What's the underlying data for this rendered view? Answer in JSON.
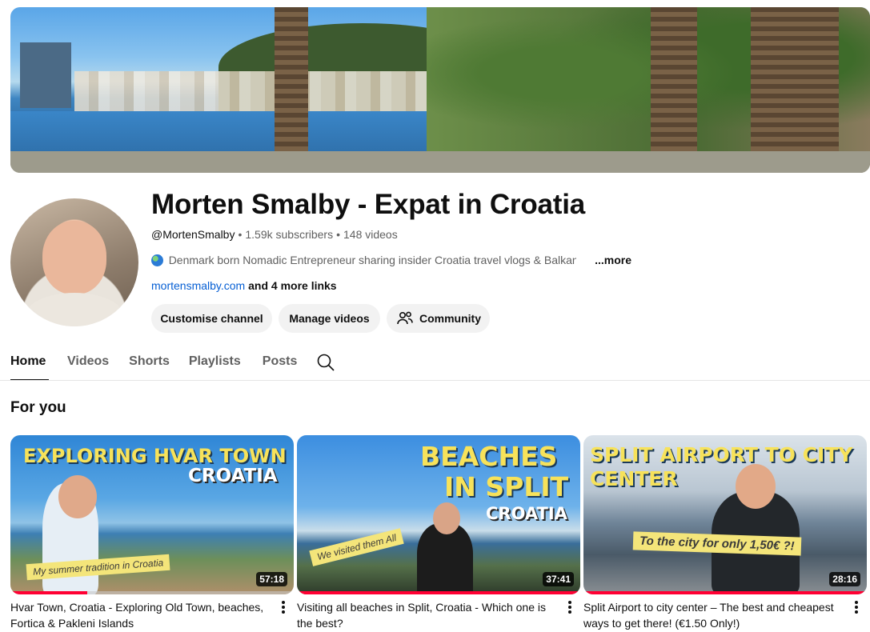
{
  "channel": {
    "title": "Morten Smalby - Expat in Croatia",
    "handle": "@MortenSmalby",
    "subscribers": "1.59k subscribers",
    "videos": "148 videos",
    "description": "Denmark born Nomadic Entrepreneur sharing insider Croatia travel vlogs & Balkan",
    "more_label": "...more",
    "link": "mortensmalby.com",
    "more_links": "and 4 more links"
  },
  "buttons": {
    "customise": "Customise channel",
    "manage": "Manage videos",
    "community": "Community"
  },
  "tabs": [
    {
      "label": "Home",
      "active": true
    },
    {
      "label": "Videos",
      "active": false
    },
    {
      "label": "Shorts",
      "active": false
    },
    {
      "label": "Playlists",
      "active": false
    },
    {
      "label": "Posts",
      "active": false
    }
  ],
  "section": {
    "title": "For you"
  },
  "videos": [
    {
      "title": "Hvar Town, Croatia - Exploring Old Town, beaches, Fortica & Pakleni Islands",
      "duration": "57:18",
      "thumb_line1": "EXPLORING HVAR TOWN",
      "thumb_line2": "CROATIA",
      "thumb_sticker": "My summer tradition in Croatia",
      "watched_fraction": 0.27
    },
    {
      "title": "Visiting all beaches in Split, Croatia - Which one is the best?",
      "duration": "37:41",
      "thumb_line1": "BEACHES",
      "thumb_line2": "IN SPLIT",
      "thumb_line3": "CROATIA",
      "thumb_sticker": "We visited them All",
      "watched_fraction": 1.0
    },
    {
      "title": "Split Airport to city center – The best and cheapest ways to get there! (€1.50 Only!)",
      "duration": "28:16",
      "thumb_line1": "SPLIT AIRPORT TO CITY",
      "thumb_line2": "CENTER",
      "thumb_sticker": "To the city for only 1,50€ ?!",
      "watched_fraction": 1.0
    }
  ],
  "icons": {
    "search": "search-icon",
    "community": "people-icon",
    "globe": "globe-icon",
    "menu": "more-vert-icon"
  },
  "colors": {
    "link": "#065fd4",
    "progress": "#ff0033",
    "button_bg": "#f2f2f2"
  }
}
